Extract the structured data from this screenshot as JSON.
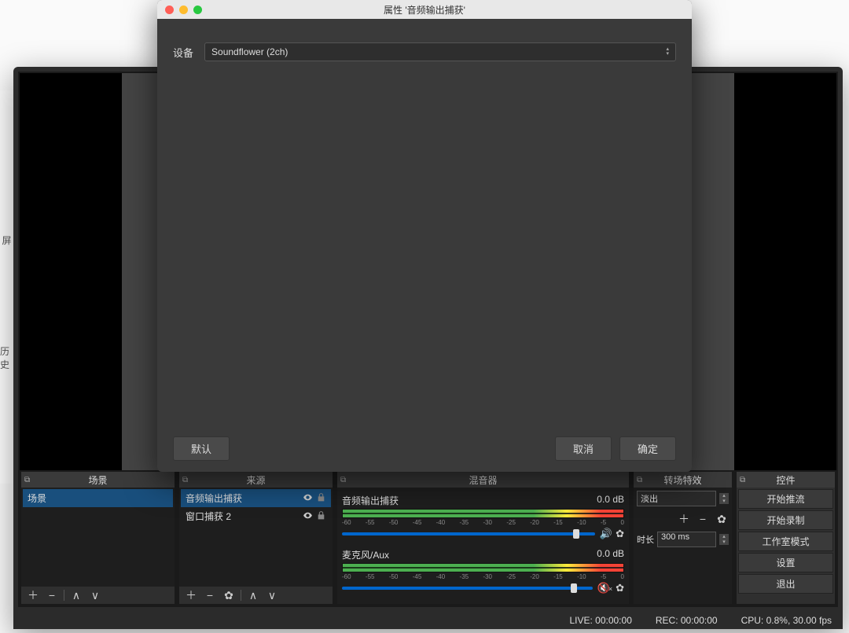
{
  "modal": {
    "title": "属性 '音频输出捕获'",
    "device_label": "设备",
    "device_value": "Soundflower (2ch)",
    "default_btn": "默认",
    "cancel_btn": "取消",
    "ok_btn": "确定"
  },
  "panels": {
    "scenes": {
      "title": "场景",
      "items": [
        "场景"
      ]
    },
    "sources": {
      "title": "来源",
      "items": [
        "音频输出捕获",
        "窗口捕获 2"
      ]
    },
    "mixer": {
      "title": "混音器",
      "ch1": {
        "name": "音频输出捕获",
        "db": "0.0 dB"
      },
      "ch2": {
        "name": "麦克风/Aux",
        "db": "0.0 dB"
      },
      "ticks": [
        "-60",
        "-55",
        "-50",
        "-45",
        "-40",
        "-35",
        "-30",
        "-25",
        "-20",
        "-15",
        "-10",
        "-5",
        "0"
      ]
    },
    "transitions": {
      "title": "转场特效",
      "mode": "淡出",
      "dur_label": "时长",
      "dur_value": "300 ms"
    },
    "controls": {
      "title": "控件",
      "buttons": [
        "开始推流",
        "开始录制",
        "工作室模式",
        "设置",
        "退出"
      ]
    }
  },
  "status": {
    "live": "LIVE: 00:00:00",
    "rec": "REC: 00:00:00",
    "cpu": "CPU: 0.8%, 30.00 fps"
  },
  "bg": {
    "label1": "屏",
    "label2": "历史"
  }
}
